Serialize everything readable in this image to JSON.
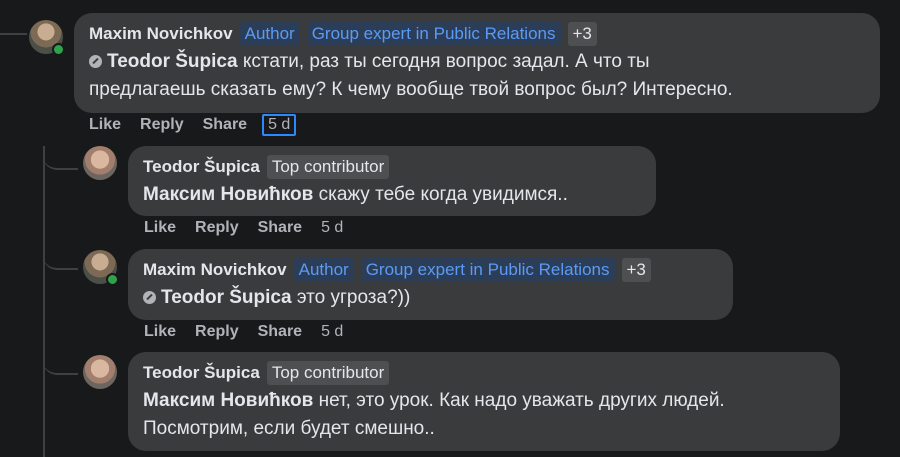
{
  "comments": [
    {
      "author": "Maxim Novichkov",
      "badges": [
        "Author",
        "Group expert in Public Relations"
      ],
      "more_badges": "+3",
      "mention": "Teodor Šupica",
      "text_line1": " кстати, раз ты сегодня вопрос задал. А что ты",
      "text_line2": "предлагаешь сказать ему? К чему вообще твой вопрос был? Интересно.",
      "actions": {
        "like": "Like",
        "reply": "Reply",
        "share": "Share",
        "time": "5 d"
      }
    },
    {
      "author": "Teodor Šupica",
      "badges": [
        "Top contributor"
      ],
      "mention": "Максим Новићков",
      "text": " скажу тебе когда увидимся..",
      "actions": {
        "like": "Like",
        "reply": "Reply",
        "share": "Share",
        "time": "5 d"
      }
    },
    {
      "author": "Maxim Novichkov",
      "badges": [
        "Author",
        "Group expert in Public Relations"
      ],
      "more_badges": "+3",
      "mention": "Teodor Šupica",
      "text": " это угроза?))",
      "actions": {
        "like": "Like",
        "reply": "Reply",
        "share": "Share",
        "time": "5 d"
      }
    },
    {
      "author": "Teodor Šupica",
      "badges": [
        "Top contributor"
      ],
      "mention": "Максим Новићков",
      "text_line1": " нет, это урок. Как надо уважать других людей.",
      "text_line2": "Посмотрим, если будет смешно.."
    }
  ],
  "icons": {
    "mention": "mention-icon",
    "online": "online-status-dot"
  },
  "colors": {
    "background": "#18191a",
    "bubble": "#3a3b3c",
    "badge_bg": "#2c3e57",
    "badge_text": "#5b9af5",
    "online": "#31a24c",
    "focus": "#2d88ff"
  }
}
